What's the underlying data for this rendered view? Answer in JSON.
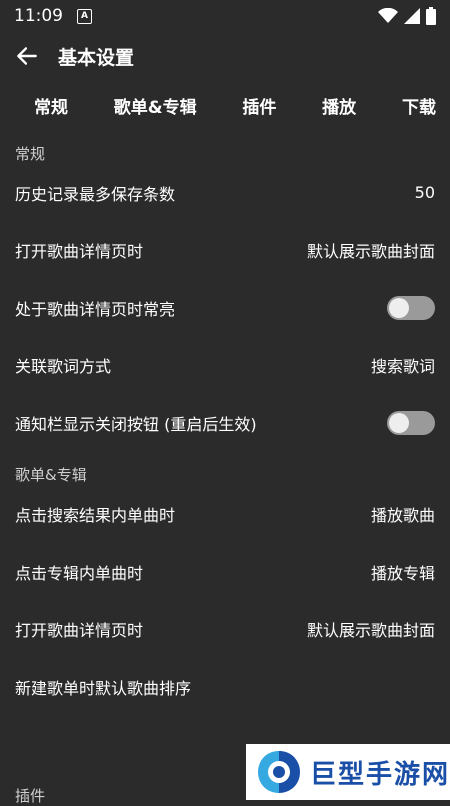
{
  "status_bar": {
    "time": "11:09",
    "notification_icon_letter": "A"
  },
  "app_bar": {
    "title": "基本设置"
  },
  "tabs": [
    "常规",
    "歌单&专辑",
    "插件",
    "播放",
    "下载"
  ],
  "sections": {
    "general": {
      "header": "常规",
      "items": [
        {
          "label": "历史记录最多保存条数",
          "value": "50"
        },
        {
          "label": "打开歌曲详情页时",
          "value": "默认展示歌曲封面"
        },
        {
          "label": "处于歌曲详情页时常亮",
          "toggle": false
        },
        {
          "label": "关联歌词方式",
          "value": "搜索歌词"
        },
        {
          "label": "通知栏显示关闭按钮 (重启后生效)",
          "toggle": false
        }
      ]
    },
    "playlist": {
      "header": "歌单&专辑",
      "items": [
        {
          "label": "点击搜索结果内单曲时",
          "value": "播放歌曲"
        },
        {
          "label": "点击专辑内单曲时",
          "value": "播放专辑"
        },
        {
          "label": "打开歌曲详情页时",
          "value": "默认展示歌曲封面"
        },
        {
          "label": "新建歌单时默认歌曲排序",
          "value": ""
        }
      ]
    }
  },
  "footer_partial": "插件",
  "watermark": {
    "text": "巨型手游网"
  },
  "colors": {
    "background": "#2b2b2b",
    "toggle_track": "#9a9a9a",
    "watermark_text": "#1a4fa8"
  }
}
